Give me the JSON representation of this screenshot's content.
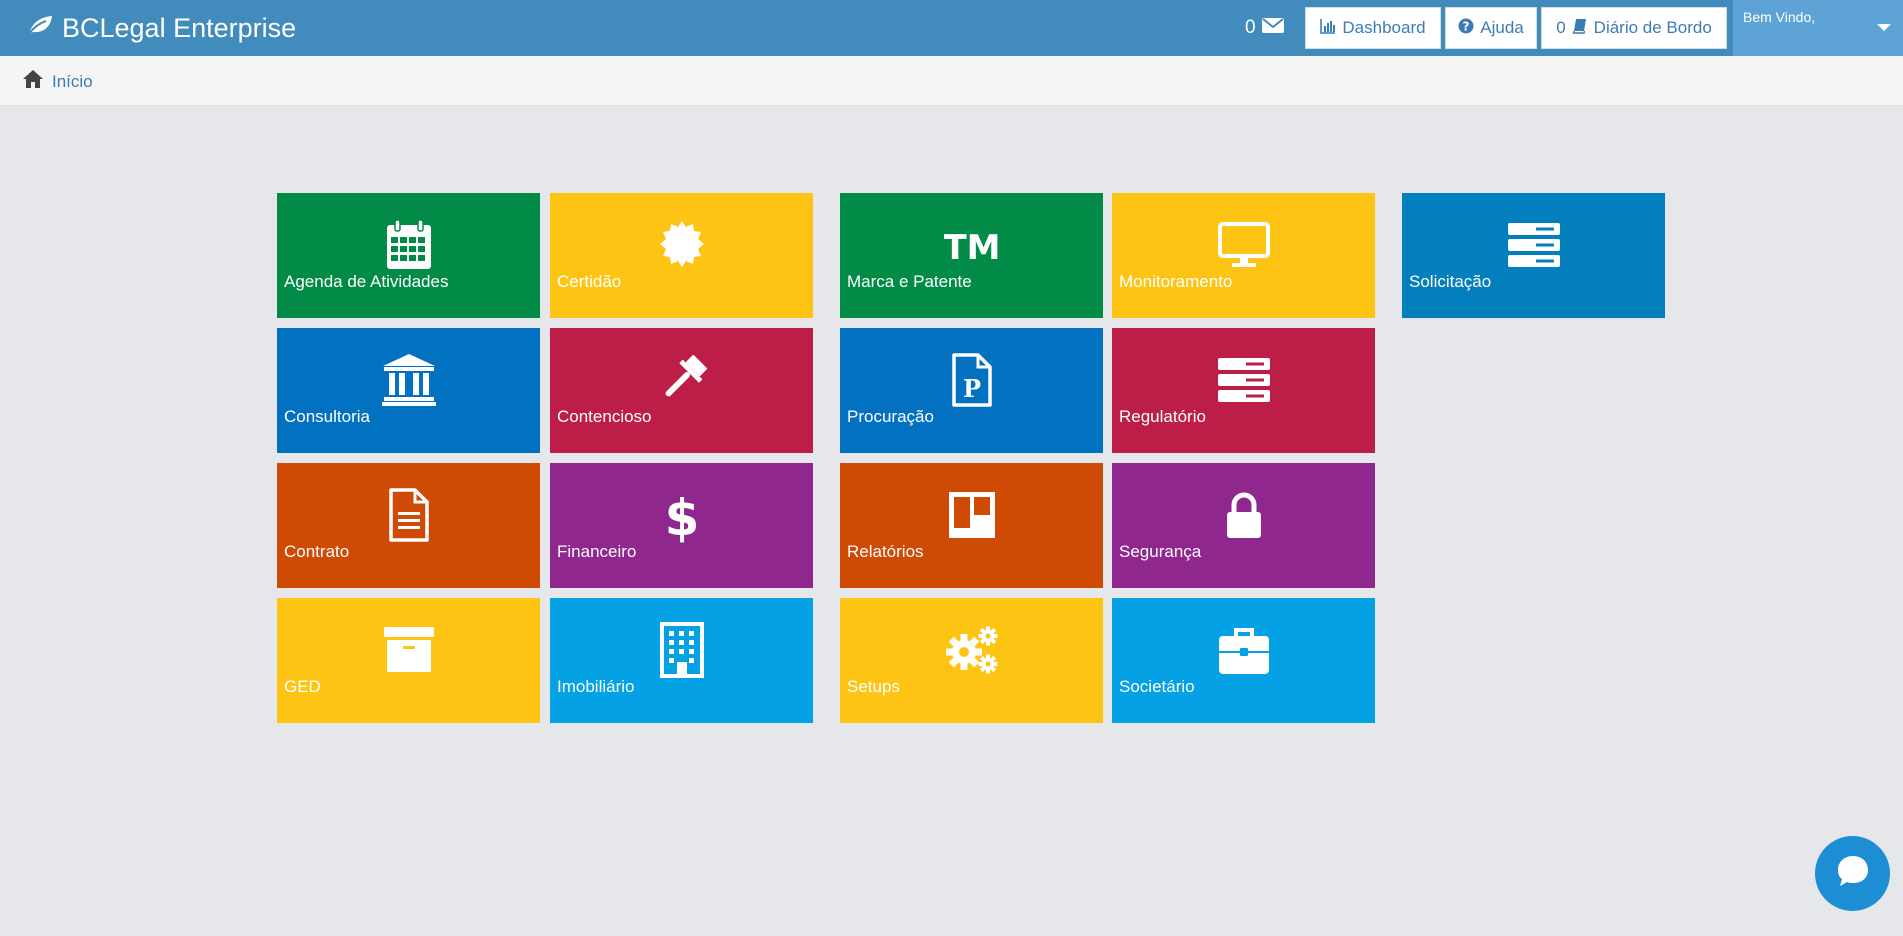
{
  "app": {
    "title": "BCLegal Enterprise"
  },
  "topbar": {
    "messages_count": "0",
    "dashboard_label": "Dashboard",
    "help_label": "Ajuda",
    "diary_count": "0",
    "diary_label": "Diário de Bordo",
    "welcome": "Bem Vindo,"
  },
  "breadcrumb": {
    "home_label": "Início"
  },
  "tiles": [
    {
      "label": "Agenda de Atividades",
      "icon": "calendar-icon",
      "color": "#028b46"
    },
    {
      "label": "Certidão",
      "icon": "certificate-icon",
      "color": "#fec413"
    },
    {
      "label": "Marca e Patente",
      "icon": "trademark-icon",
      "color": "#028b46"
    },
    {
      "label": "Monitoramento",
      "icon": "monitor-icon",
      "color": "#fec413"
    },
    {
      "label": "Solicitação",
      "icon": "server-icon",
      "color": "#037fbe"
    },
    {
      "label": "Consultoria",
      "icon": "bank-icon",
      "color": "#0371c1"
    },
    {
      "label": "Contencioso",
      "icon": "gavel-icon",
      "color": "#bc1e48"
    },
    {
      "label": "Procuração",
      "icon": "document-p-icon",
      "color": "#0371c1"
    },
    {
      "label": "Regulatório",
      "icon": "server-icon",
      "color": "#bc1e48"
    },
    {
      "label": "Contrato",
      "icon": "file-text-icon",
      "color": "#cf4a05"
    },
    {
      "label": "Financeiro",
      "icon": "dollar-icon",
      "color": "#90278f"
    },
    {
      "label": "Relatórios",
      "icon": "board-icon",
      "color": "#cf4a05"
    },
    {
      "label": "Segurança",
      "icon": "lock-icon",
      "color": "#90278f"
    },
    {
      "label": "GED",
      "icon": "archive-icon",
      "color": "#fec413"
    },
    {
      "label": "Imobiliário",
      "icon": "building-icon",
      "color": "#04a1e5"
    },
    {
      "label": "Setups",
      "icon": "gears-icon",
      "color": "#fec413"
    },
    {
      "label": "Societário",
      "icon": "briefcase-icon",
      "color": "#04a1e5"
    }
  ],
  "chat": {
    "icon": "chat-bubble-icon"
  }
}
